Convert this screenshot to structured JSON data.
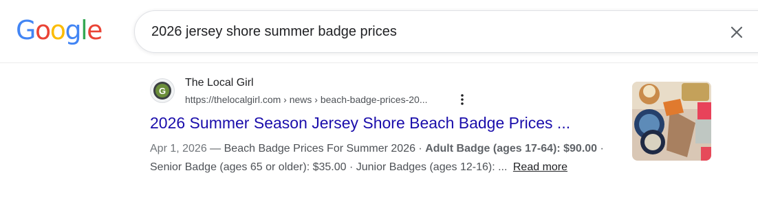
{
  "header": {
    "logo_text": "Google",
    "logo_letters": [
      {
        "ch": "G",
        "color": "#4285F4"
      },
      {
        "ch": "o",
        "color": "#EA4335"
      },
      {
        "ch": "o",
        "color": "#FBBC05"
      },
      {
        "ch": "g",
        "color": "#4285F4"
      },
      {
        "ch": "l",
        "color": "#34A853"
      },
      {
        "ch": "e",
        "color": "#EA4335"
      }
    ],
    "search_query": "2026 jersey shore summer badge prices",
    "clear_icon": "close-icon"
  },
  "result": {
    "site_name": "The Local Girl",
    "site_url": "https://thelocalgirl.com › news › beach-badge-prices-20...",
    "favicon_icon": "thelocalgirl-favicon-icon",
    "more_icon": "vertical-dots-icon",
    "title": "2026 Summer Season Jersey Shore Beach Badge Prices ...",
    "date": "Apr 1, 2026",
    "snippet_sep": " — ",
    "snippet_part1": "Beach Badge Prices For Summer 2026 · ",
    "snippet_bold1": "Adult Badge (ages 17-64): $90.00",
    "snippet_part2": " · Senior Badge (ages 65 or older): $35.00 · Junior Badges (ages 12-16): ...",
    "read_more": "Read more",
    "thumbnail_icon": "beach-badges-collage-image"
  },
  "colors": {
    "link_blue": "#1a0dab",
    "text_dark": "#202124",
    "text_gray": "#4d5156"
  }
}
